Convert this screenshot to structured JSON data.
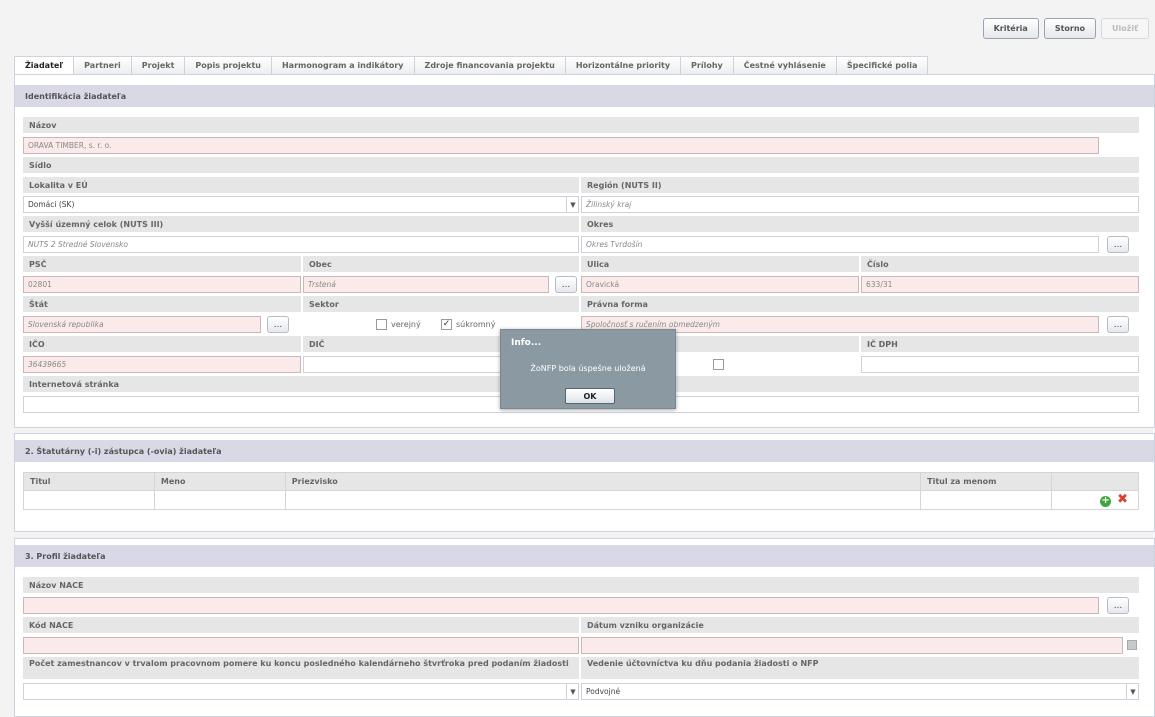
{
  "toolbar": {
    "criteria": "Kritéria",
    "cancel": "Storno",
    "save": "Uložiť"
  },
  "tabs": [
    "Žiadateľ",
    "Partneri",
    "Projekt",
    "Popis projektu",
    "Harmonogram a indikátory",
    "Zdroje financovania projektu",
    "Horizontálne priority",
    "Prílohy",
    "Čestné vyhlásenie",
    "Špecifické polia"
  ],
  "section1": {
    "title": "Identifikácia žiadateľa",
    "name_label": "Názov",
    "name_value": "ORAVA TIMBER, s. r. o.",
    "seat_label": "Sídlo",
    "locality_label": "Lokalita v EÚ",
    "locality_value": "Domáci (SK)",
    "region_label": "Región (NUTS II)",
    "region_value": "Žilinský kraj",
    "vuc_label": "Vyšší územný celok (NUTS III)",
    "vuc_value": "NUTS 2 Stredné Slovensko",
    "district_label": "Okres",
    "district_value": "Okres Tvrdošín",
    "psc_label": "PSČ",
    "psc_value": "02801",
    "obec_label": "Obec",
    "obec_value": "Trstená",
    "street_label": "Ulica",
    "street_value": "Oravická",
    "number_label": "Číslo",
    "number_value": "633/31",
    "state_label": "Štát",
    "state_value": "Slovenská republika",
    "sector_label": "Sektor",
    "sector_public": "verejný",
    "sector_private": "súkromný",
    "legal_label": "Právna forma",
    "legal_value": "Spoločnosť s ručením obmedzeným",
    "ico_label": "IČO",
    "ico_value": "36439665",
    "dic_label": "DIČ",
    "icdph_label": "IČ DPH",
    "web_label": "Internetová stránka",
    "dots": "..."
  },
  "section2": {
    "title": "2. Štatutárny (-i) zástupca (-ovia) žiadateľa",
    "columns": [
      "Titul",
      "Meno",
      "Priezvisko",
      "Titul za menom"
    ]
  },
  "section3": {
    "title": "3. Profil žiadateľa",
    "nace_name_label": "Názov NACE",
    "nace_code_label": "Kód NACE",
    "founded_label": "Dátum vzniku organizácie",
    "employees_label": "Počet zamestnancov v trvalom pracovnom pomere ku koncu posledného kalendárneho štvrťroka pred podaním žiadosti",
    "accounting_label": "Vedenie účtovníctva ku dňu podania žiadosti o NFP",
    "accounting_value": "Podvojné"
  },
  "dialog": {
    "title": "Info...",
    "message": "ŽoNFP bola úspešne uložená",
    "ok": "OK"
  }
}
